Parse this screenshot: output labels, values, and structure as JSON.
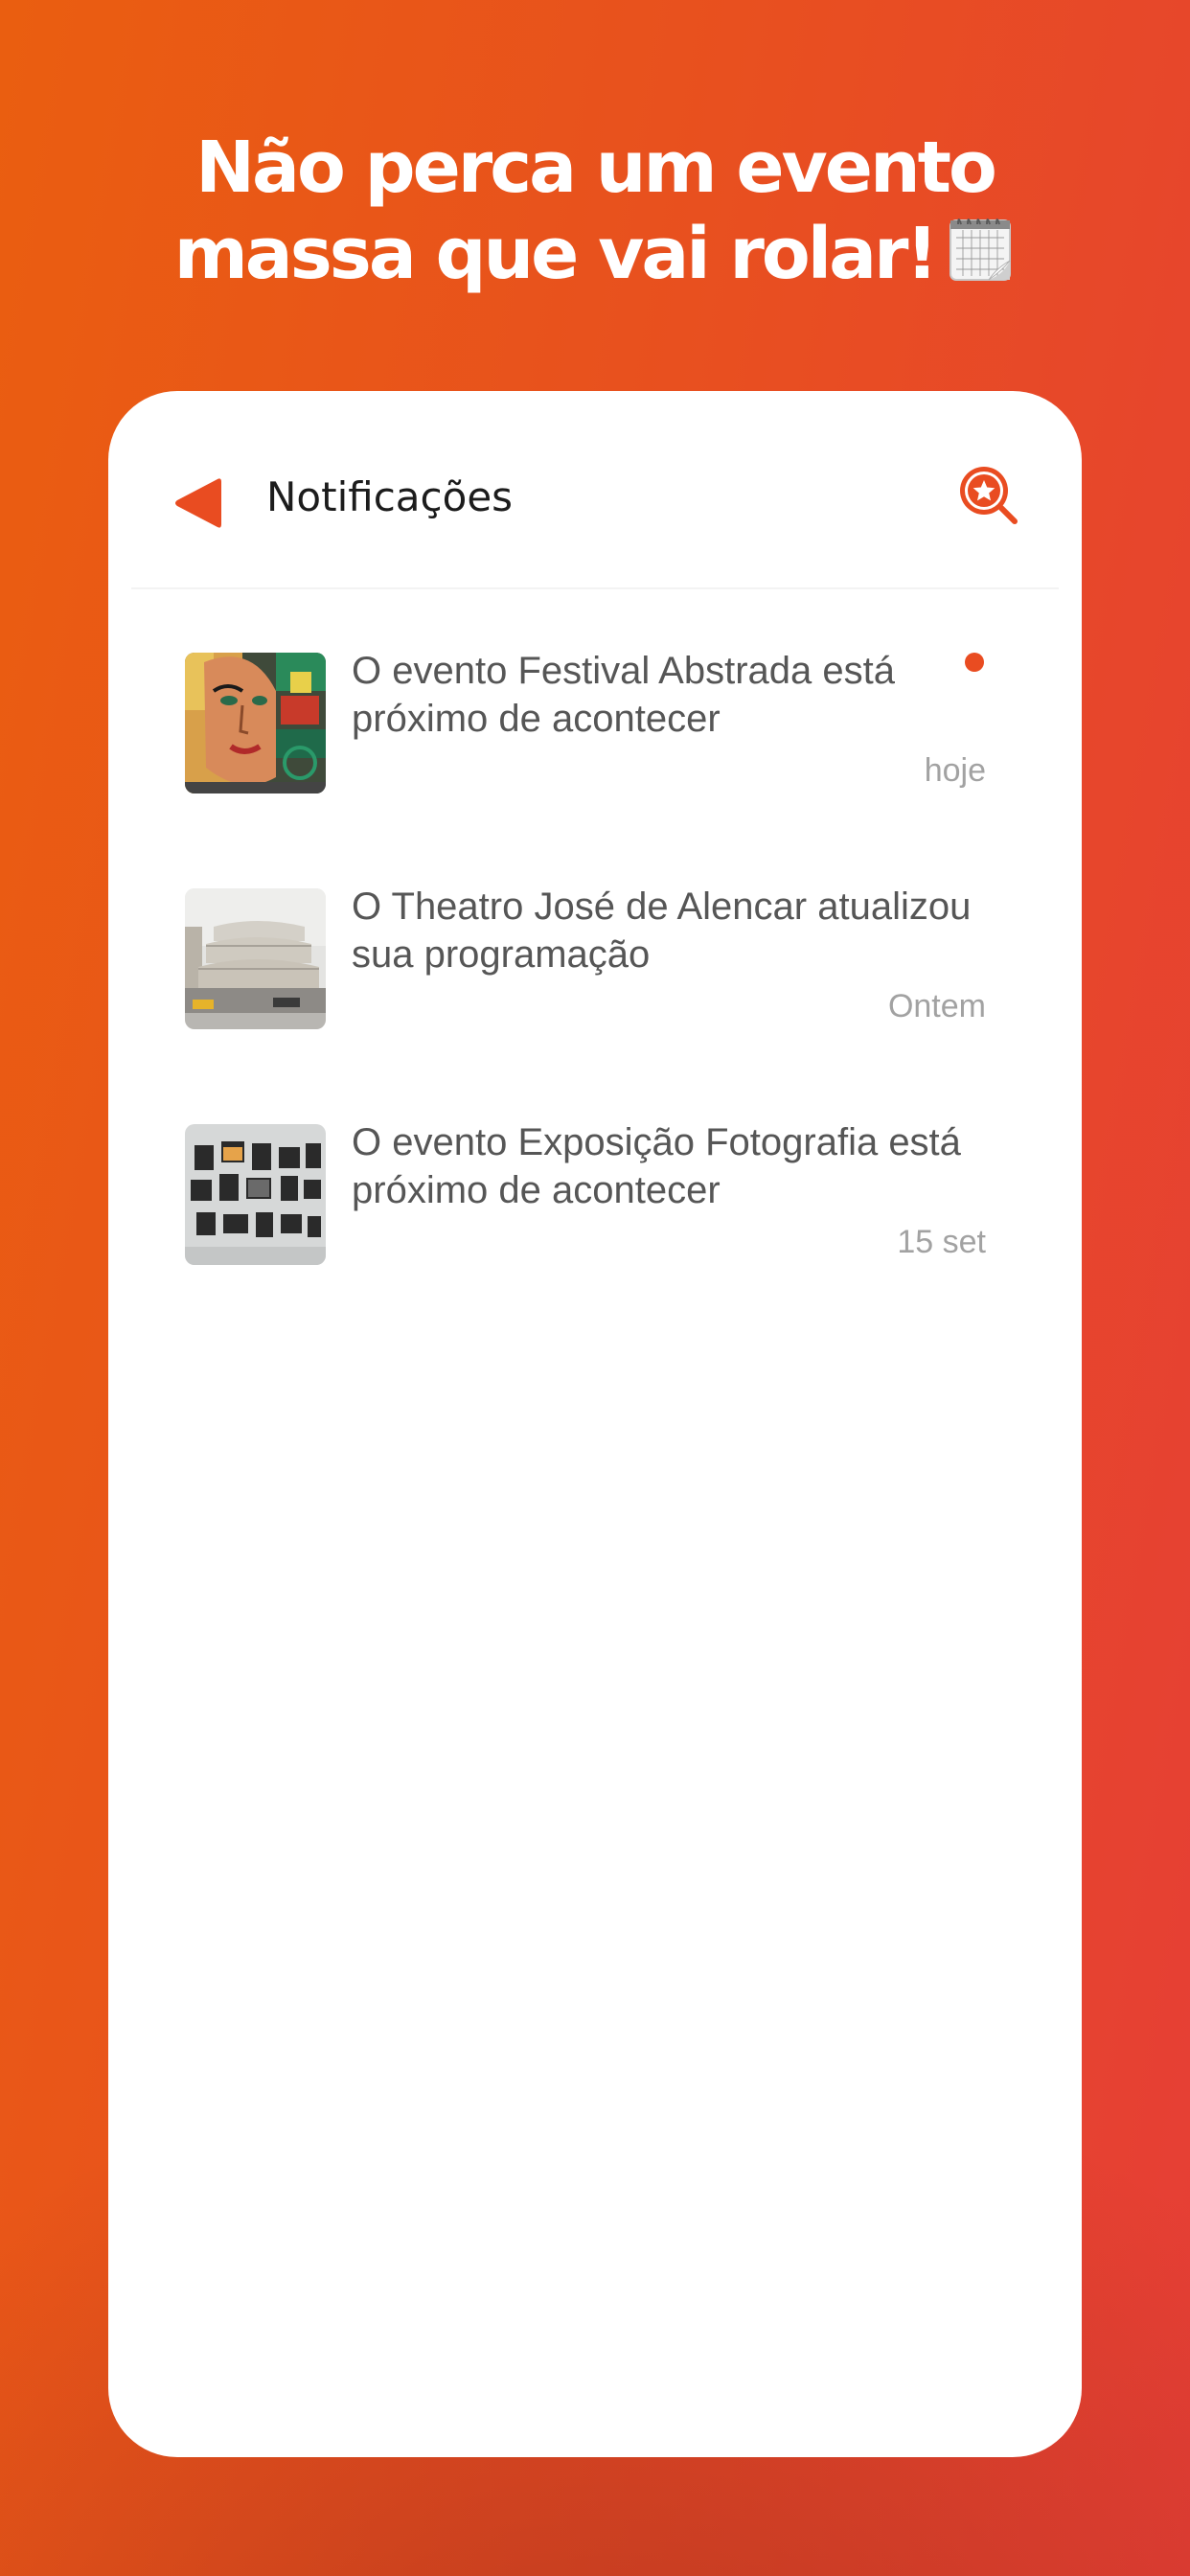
{
  "headline": {
    "line1": "Não perca um evento",
    "line2": "massa que vai rolar!",
    "emoji_icon": "spiral-calendar-icon"
  },
  "header": {
    "title": "Notificações",
    "back_icon": "back-triangle-icon",
    "search_icon": "star-search-icon"
  },
  "notifications": [
    {
      "text": "O evento Festival Abstrada está próximo de acontecer",
      "time": "hoje",
      "unread": true,
      "image": "street-art-mural-thumbnail"
    },
    {
      "text": "O Theatro José de Alencar atualizou sua programação",
      "time": "Ontem",
      "unread": false,
      "image": "theater-building-thumbnail"
    },
    {
      "text": "O evento Exposição Fotografia está próximo de acontecer",
      "time": "15 set",
      "unread": false,
      "image": "photo-exhibition-thumbnail"
    }
  ],
  "colors": {
    "accent": "#e94c21",
    "background_start": "#ea5e10",
    "background_end": "#e63e36",
    "card": "#ffffff",
    "text": "#565656",
    "muted": "#a2a2a2"
  }
}
